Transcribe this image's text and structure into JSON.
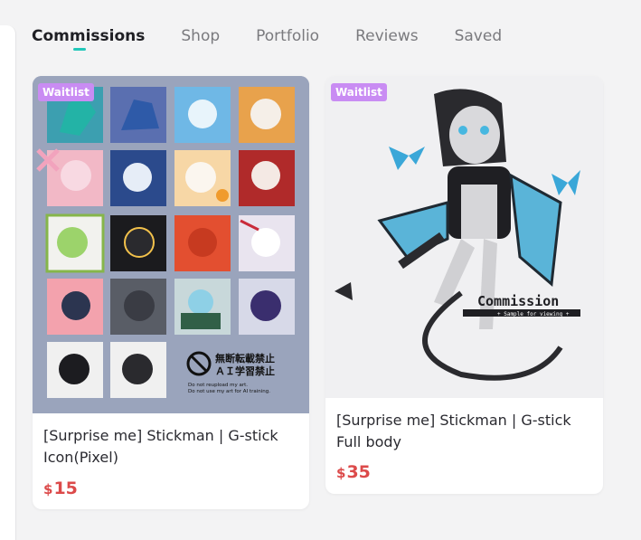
{
  "tabs": [
    {
      "label": "Commissions",
      "active": true
    },
    {
      "label": "Shop",
      "active": false
    },
    {
      "label": "Portfolio",
      "active": false
    },
    {
      "label": "Reviews",
      "active": false
    },
    {
      "label": "Saved",
      "active": false
    }
  ],
  "cards": [
    {
      "badge": "Waitlist",
      "title": "[Surprise me] Stickman | G-stick Icon(Pixel)",
      "currency": "$",
      "price": "15",
      "image_text": {
        "kanji1": "無断転載禁止",
        "kanji2": "ＡＩ学習禁止",
        "notice1": "Do not reupload my art.",
        "notice2": "Do not use my art for AI training."
      }
    },
    {
      "badge": "Waitlist",
      "title": "[Surprise me] Stickman | G-stick Full body",
      "currency": "$",
      "price": "35",
      "image_text": {
        "wordmark": "Commission",
        "tagline": "+ Sample for viewing +"
      }
    }
  ],
  "colors": {
    "accent": "#22c7b9",
    "badge": "#c98cf3",
    "price": "#dc4a4a"
  }
}
